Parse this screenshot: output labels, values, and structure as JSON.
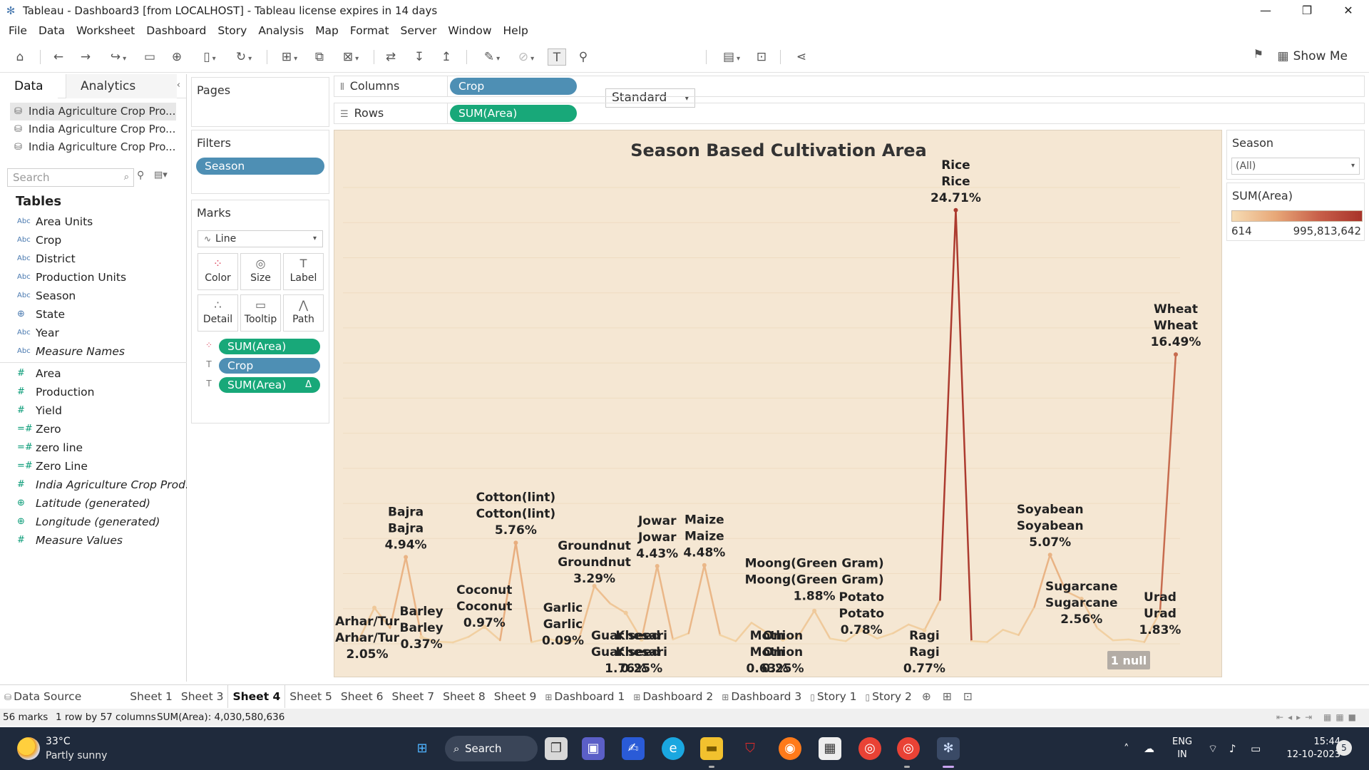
{
  "window": {
    "title": "Tableau - Dashboard3 [from LOCALHOST] - Tableau license expires in 14 days",
    "controls": [
      "—",
      "❐",
      "✕"
    ]
  },
  "menu": [
    "File",
    "Data",
    "Worksheet",
    "Dashboard",
    "Story",
    "Analysis",
    "Map",
    "Format",
    "Server",
    "Window",
    "Help"
  ],
  "toolbar": {
    "fit_select": "Standard",
    "show_me": "Show Me"
  },
  "datapane": {
    "tabs": [
      "Data",
      "Analytics"
    ],
    "datasources": [
      "India Agriculture Crop Pro...",
      "India Agriculture Crop Pro...",
      "India Agriculture Crop Pro..."
    ],
    "search_placeholder": "Search",
    "tables_label": "Tables",
    "dimensions": [
      {
        "name": "Area Units",
        "type": "Abc"
      },
      {
        "name": "Crop",
        "type": "Abc"
      },
      {
        "name": "District",
        "type": "Abc"
      },
      {
        "name": "Production Units",
        "type": "Abc"
      },
      {
        "name": "Season",
        "type": "Abc"
      },
      {
        "name": "State",
        "type": "geo"
      },
      {
        "name": "Year",
        "type": "Abc"
      },
      {
        "name": "Measure Names",
        "type": "Abc",
        "italic": true
      }
    ],
    "measures": [
      {
        "name": "Area",
        "type": "#"
      },
      {
        "name": "Production",
        "type": "#"
      },
      {
        "name": "Yield",
        "type": "#"
      },
      {
        "name": "Zero",
        "type": "=#"
      },
      {
        "name": "zero line",
        "type": "=#"
      },
      {
        "name": "Zero Line",
        "type": "=#"
      },
      {
        "name": "India Agriculture Crop Prod...",
        "type": "#",
        "italic": true
      },
      {
        "name": "Latitude (generated)",
        "type": "geo",
        "italic": true
      },
      {
        "name": "Longitude (generated)",
        "type": "geo",
        "italic": true
      },
      {
        "name": "Measure Values",
        "type": "#",
        "italic": true
      }
    ]
  },
  "shelves": {
    "pages_label": "Pages",
    "filters_label": "Filters",
    "filters": [
      "Season"
    ],
    "marks_label": "Marks",
    "mark_type": "Line",
    "mark_buttons": [
      "Color",
      "Size",
      "Label",
      "Detail",
      "Tooltip",
      "Path"
    ],
    "mark_pills": [
      "SUM(Area)",
      "Crop",
      "SUM(Area)"
    ],
    "mark_delta": "Δ",
    "columns_label": "Columns",
    "columns_pill": "Crop",
    "rows_label": "Rows",
    "rows_pill": "SUM(Area)"
  },
  "legend": {
    "season_title": "Season",
    "season_value": "(All)",
    "sum_title": "SUM(Area)",
    "min": "614",
    "max": "995,813,642"
  },
  "chart_data": {
    "type": "line",
    "title": "Season Based Cultivation Area",
    "null_badge": "1 null",
    "points": [
      0.2,
      2.05,
      0.9,
      4.94,
      0.37,
      0.12,
      0.08,
      0.4,
      0.97,
      0.2,
      5.76,
      0.09,
      0.3,
      0.09,
      0.2,
      3.29,
      2.3,
      1.76,
      0.25,
      4.43,
      0.25,
      0.6,
      4.48,
      0.5,
      0.15,
      1.2,
      0.63,
      0.25,
      0.45,
      1.88,
      0.3,
      0.15,
      0.78,
      0.3,
      0.6,
      1.1,
      0.77,
      2.5,
      24.71,
      0.15,
      0.1,
      0.8,
      0.5,
      2.1,
      5.07,
      3.0,
      2.56,
      0.9,
      0.2,
      0.25,
      0.1,
      1.83,
      16.49
    ],
    "labels": [
      {
        "i": 1,
        "lines": [
          "Arhar/Tur",
          "Arhar/Tur",
          "2.05%"
        ]
      },
      {
        "i": 3,
        "lines": [
          "Bajra",
          "Bajra",
          "4.94%"
        ]
      },
      {
        "i": 4,
        "lines": [
          "Barley",
          "Barley",
          "0.37%"
        ]
      },
      {
        "i": 8,
        "lines": [
          "Coconut",
          "Coconut",
          "0.97%"
        ]
      },
      {
        "i": 10,
        "lines": [
          "Cotton(lint)",
          "Cotton(lint)",
          "5.76%"
        ]
      },
      {
        "i": 13,
        "lines": [
          "Garlic",
          "Garlic",
          "0.09%"
        ]
      },
      {
        "i": 15,
        "lines": [
          "Groundnut",
          "Groundnut",
          "3.29%"
        ]
      },
      {
        "i": 17,
        "lines": [
          "Guar seed",
          "Guar seed",
          "1.76%"
        ]
      },
      {
        "i": 18,
        "lines": [
          "Khesari",
          "Khesari",
          "0.25%"
        ]
      },
      {
        "i": 19,
        "lines": [
          "Jowar",
          "Jowar",
          "4.43%"
        ]
      },
      {
        "i": 22,
        "lines": [
          "Maize",
          "Maize",
          "4.48%"
        ]
      },
      {
        "i": 26,
        "lines": [
          "Moth",
          "Moth",
          "0.63%"
        ]
      },
      {
        "i": 27,
        "lines": [
          "Onion",
          "Onion",
          "0.25%"
        ]
      },
      {
        "i": 29,
        "lines": [
          "Moong(Green Gram)",
          "Moong(Green Gram)",
          "1.88%"
        ]
      },
      {
        "i": 32,
        "lines": [
          "Potato",
          "Potato",
          "0.78%"
        ]
      },
      {
        "i": 36,
        "lines": [
          "Ragi",
          "Ragi",
          "0.77%"
        ]
      },
      {
        "i": 38,
        "lines": [
          "Rice",
          "Rice",
          "24.71%"
        ]
      },
      {
        "i": 44,
        "lines": [
          "Soyabean",
          "Soyabean",
          "5.07%"
        ]
      },
      {
        "i": 46,
        "lines": [
          "Sugarcane",
          "Sugarcane",
          "2.56%"
        ]
      },
      {
        "i": 51,
        "lines": [
          "Urad",
          "Urad",
          "1.83%"
        ]
      },
      {
        "i": 52,
        "lines": [
          "Wheat",
          "Wheat",
          "16.49%"
        ]
      }
    ],
    "ylim": [
      0,
      26
    ],
    "grid": true,
    "colors": {
      "low": "#f3d6a8",
      "mid": "#e4a070",
      "high": "#a8332a",
      "background": "#f5e7d3"
    }
  },
  "sheet_tabs": [
    "Data Source",
    "Sheet 1",
    "Sheet 3",
    "Sheet 4",
    "Sheet 5",
    "Sheet 6",
    "Sheet 7",
    "Sheet 8",
    "Sheet 9",
    "Dashboard 1",
    "Dashboard 2",
    "Dashboard 3",
    "Story 1",
    "Story 2"
  ],
  "active_tab": "Sheet 4",
  "status": {
    "marks": "56 marks",
    "dims": "1 row by 57 columns",
    "sum": "SUM(Area): 4,030,580,636"
  },
  "taskbar": {
    "temp": "33°C",
    "weather": "Partly sunny",
    "search": "Search",
    "lang_top": "ENG",
    "lang_bottom": "IN",
    "time": "15:44",
    "date": "12-10-2023",
    "notifications": "5"
  }
}
